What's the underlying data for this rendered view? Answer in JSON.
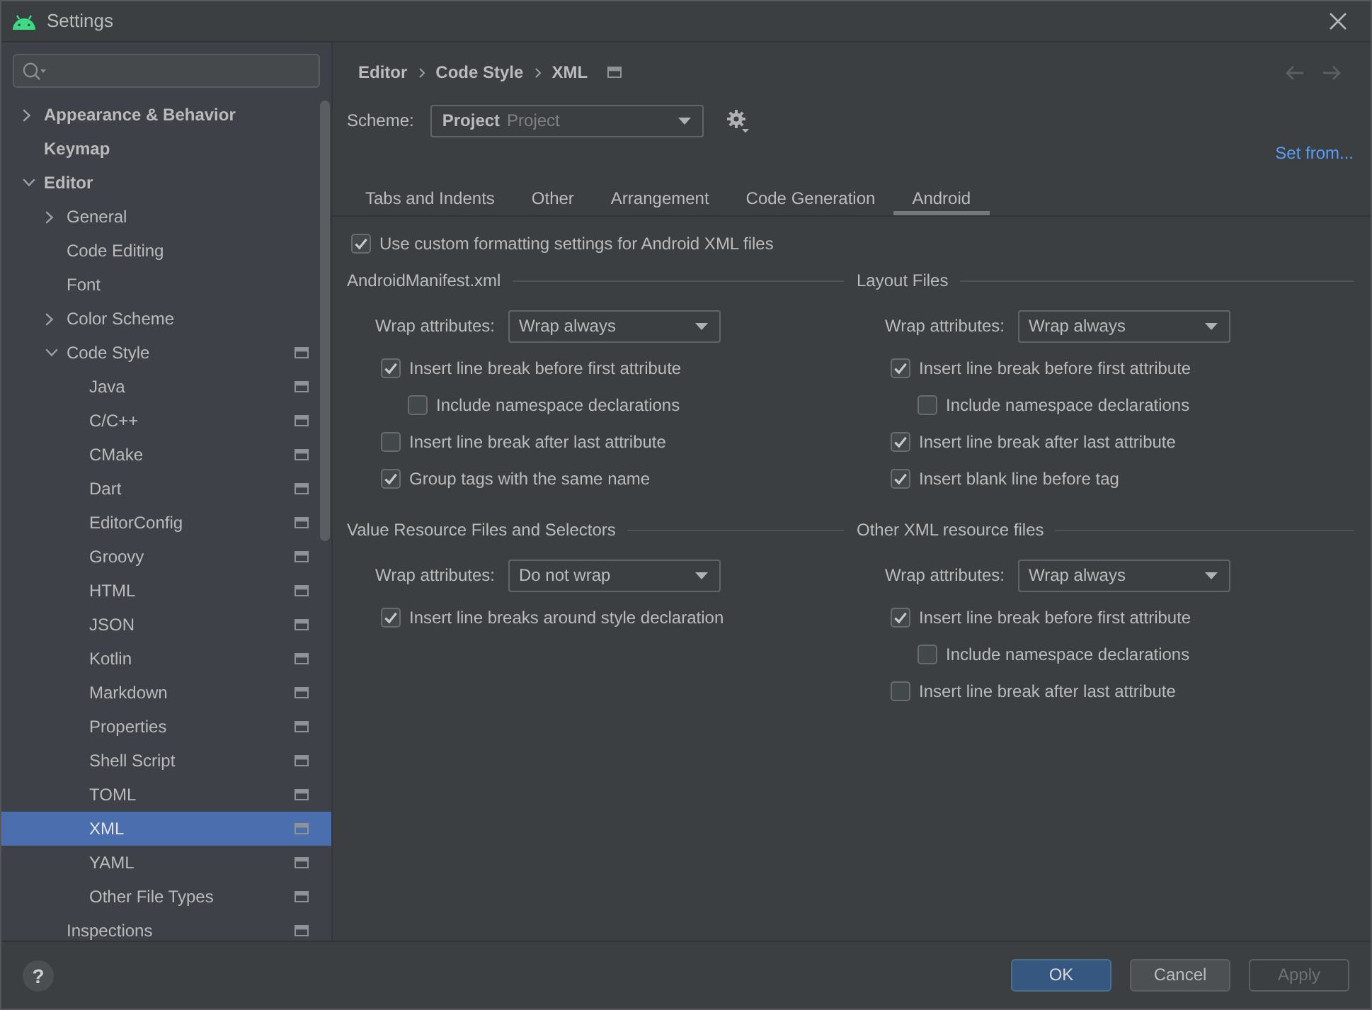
{
  "window": {
    "title": "Settings"
  },
  "sidebar": {
    "items": [
      {
        "label": "Appearance & Behavior",
        "expanded": false,
        "selected": false,
        "project_scope": false
      },
      {
        "label": "Keymap",
        "selected": false,
        "project_scope": false
      },
      {
        "label": "Editor",
        "expanded": true,
        "selected": false,
        "project_scope": false,
        "children": [
          {
            "label": "General",
            "expanded": false,
            "selected": false,
            "project_scope": false
          },
          {
            "label": "Code Editing",
            "selected": false,
            "project_scope": false
          },
          {
            "label": "Font",
            "selected": false,
            "project_scope": false
          },
          {
            "label": "Color Scheme",
            "expanded": false,
            "selected": false,
            "project_scope": false
          },
          {
            "label": "Code Style",
            "expanded": true,
            "selected": false,
            "project_scope": true,
            "children": [
              {
                "label": "Java",
                "selected": false,
                "project_scope": true
              },
              {
                "label": "C/C++",
                "selected": false,
                "project_scope": true
              },
              {
                "label": "CMake",
                "selected": false,
                "project_scope": true
              },
              {
                "label": "Dart",
                "selected": false,
                "project_scope": true
              },
              {
                "label": "EditorConfig",
                "selected": false,
                "project_scope": true
              },
              {
                "label": "Groovy",
                "selected": false,
                "project_scope": true
              },
              {
                "label": "HTML",
                "selected": false,
                "project_scope": true
              },
              {
                "label": "JSON",
                "selected": false,
                "project_scope": true
              },
              {
                "label": "Kotlin",
                "selected": false,
                "project_scope": true
              },
              {
                "label": "Markdown",
                "selected": false,
                "project_scope": true
              },
              {
                "label": "Properties",
                "selected": false,
                "project_scope": true
              },
              {
                "label": "Shell Script",
                "selected": false,
                "project_scope": true
              },
              {
                "label": "TOML",
                "selected": false,
                "project_scope": true
              },
              {
                "label": "XML",
                "selected": true,
                "project_scope": true
              },
              {
                "label": "YAML",
                "selected": false,
                "project_scope": true
              },
              {
                "label": "Other File Types",
                "selected": false,
                "project_scope": true
              }
            ]
          },
          {
            "label": "Inspections",
            "selected": false,
            "project_scope": true
          }
        ]
      }
    ]
  },
  "breadcrumb": {
    "items": [
      "Editor",
      "Code Style",
      "XML"
    ],
    "project_scope": true
  },
  "navigation": {
    "back_disabled": true,
    "forward_disabled": true
  },
  "scheme": {
    "label": "Scheme:",
    "value": "Project",
    "detail": "Project"
  },
  "set_from": "Set from...",
  "tabs": [
    {
      "label": "Tabs and Indents",
      "selected": false
    },
    {
      "label": "Other",
      "selected": false
    },
    {
      "label": "Arrangement",
      "selected": false
    },
    {
      "label": "Code Generation",
      "selected": false
    },
    {
      "label": "Android",
      "selected": true
    }
  ],
  "use_custom": {
    "label": "Use custom formatting settings for Android XML files",
    "checked": true
  },
  "groups": [
    {
      "title": "AndroidManifest.xml",
      "wrap_label": "Wrap attributes:",
      "wrap_value": "Wrap always",
      "options": [
        {
          "label": "Insert line break before first attribute",
          "checked": true,
          "children": [
            {
              "label": "Include namespace declarations",
              "checked": false
            }
          ]
        },
        {
          "label": "Insert line break after last attribute",
          "checked": false
        },
        {
          "label": "Group tags with the same name",
          "checked": true
        }
      ]
    },
    {
      "title": "Layout Files",
      "wrap_label": "Wrap attributes:",
      "wrap_value": "Wrap always",
      "options": [
        {
          "label": "Insert line break before first attribute",
          "checked": true,
          "children": [
            {
              "label": "Include namespace declarations",
              "checked": false
            }
          ]
        },
        {
          "label": "Insert line break after last attribute",
          "checked": true
        },
        {
          "label": "Insert blank line before tag",
          "checked": true
        }
      ]
    },
    {
      "title": "Value Resource Files and Selectors",
      "wrap_label": "Wrap attributes:",
      "wrap_value": "Do not wrap",
      "options": [
        {
          "label": "Insert line breaks around style declaration",
          "checked": true
        }
      ]
    },
    {
      "title": "Other XML resource files",
      "wrap_label": "Wrap attributes:",
      "wrap_value": "Wrap always",
      "options": [
        {
          "label": "Insert line break before first attribute",
          "checked": true,
          "children": [
            {
              "label": "Include namespace declarations",
              "checked": false
            }
          ]
        },
        {
          "label": "Insert line break after last attribute",
          "checked": false
        }
      ]
    }
  ],
  "help_button": "?",
  "buttons": [
    {
      "label": "OK",
      "kind": "primary",
      "disabled": false
    },
    {
      "label": "Cancel",
      "kind": "secondary",
      "disabled": false
    },
    {
      "label": "Apply",
      "kind": "secondary",
      "disabled": true
    }
  ]
}
